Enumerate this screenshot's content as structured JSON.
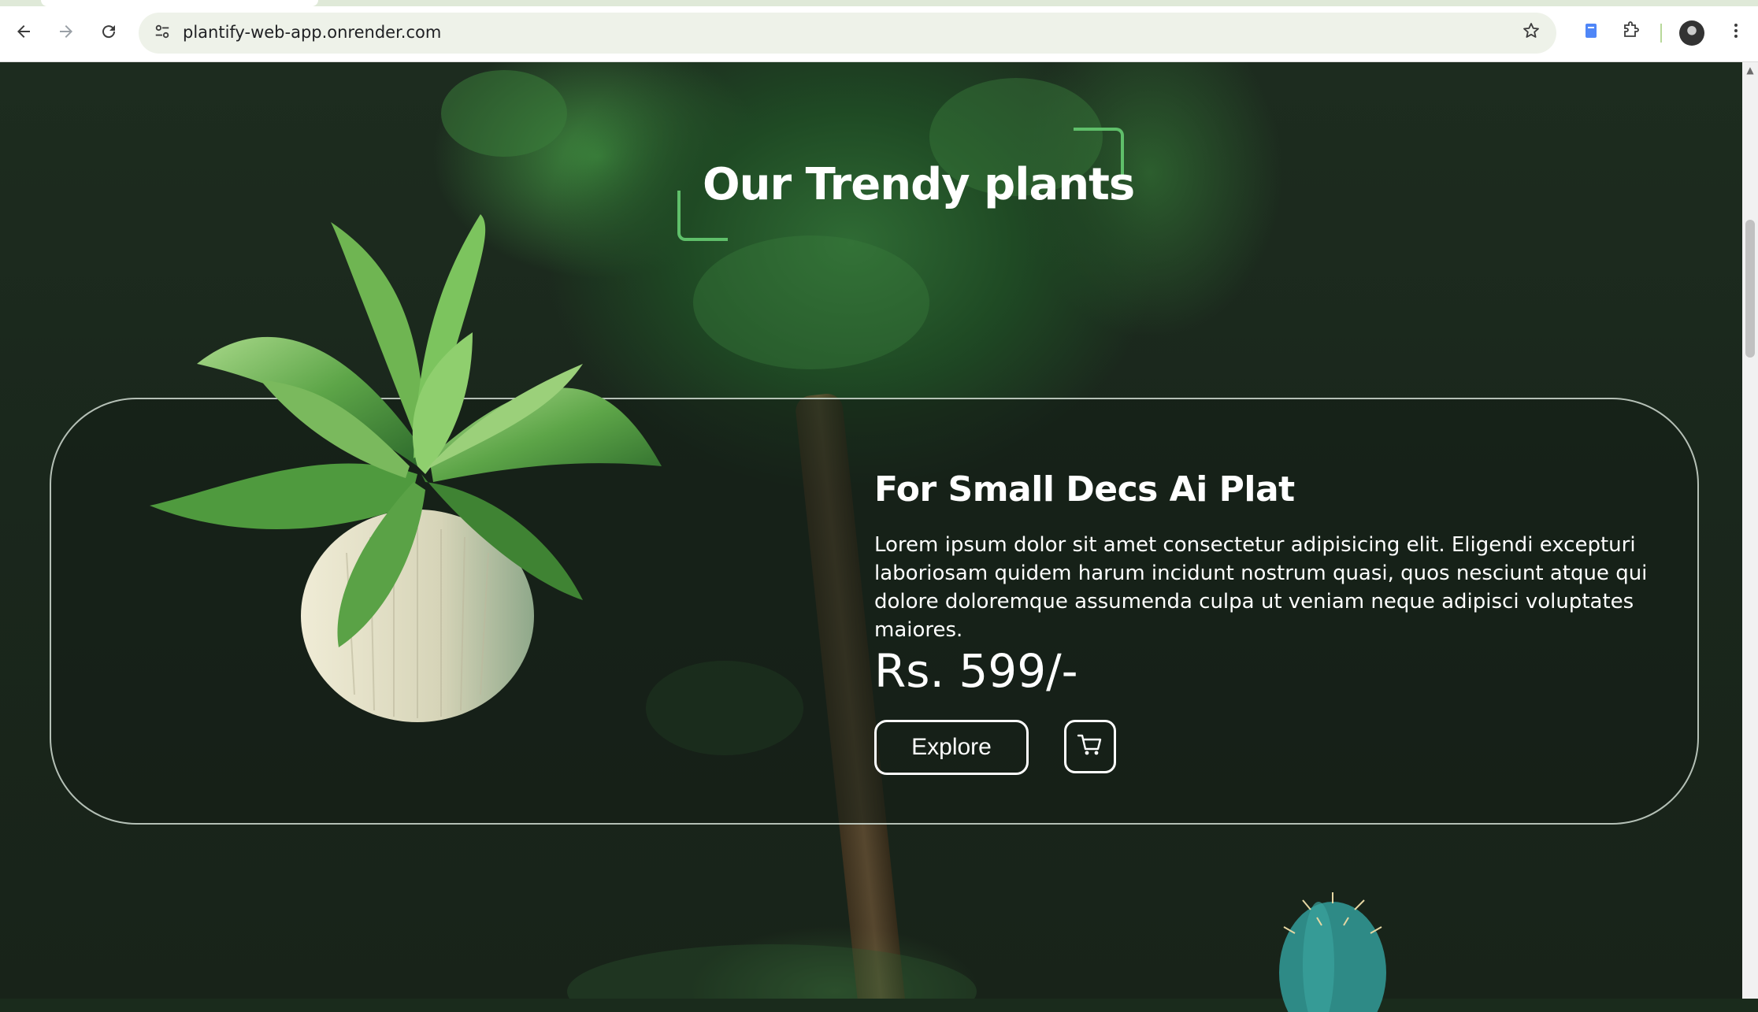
{
  "browser": {
    "url": "plantify-web-app.onrender.com",
    "back_icon": "arrow-left-icon",
    "forward_icon": "arrow-right-icon",
    "reload_icon": "reload-icon",
    "site_info_icon": "tune-icon",
    "bookmark_icon": "star-icon",
    "menu_icon": "kebab-menu-icon"
  },
  "section": {
    "heading": "Our Trendy plants",
    "accent_color": "#5fbf6a"
  },
  "product": {
    "title": "For Small Decs Ai Plat",
    "description": "Lorem ipsum dolor sit amet consectetur adipisicing elit. Eligendi excepturi laboriosam quidem harum incidunt nostrum quasi, quos nesciunt atque qui dolore doloremque assumenda culpa ut veniam neque adipisci voluptates maiores.",
    "price": "Rs. 599/-",
    "explore_label": "Explore",
    "cart_icon": "cart-icon"
  }
}
